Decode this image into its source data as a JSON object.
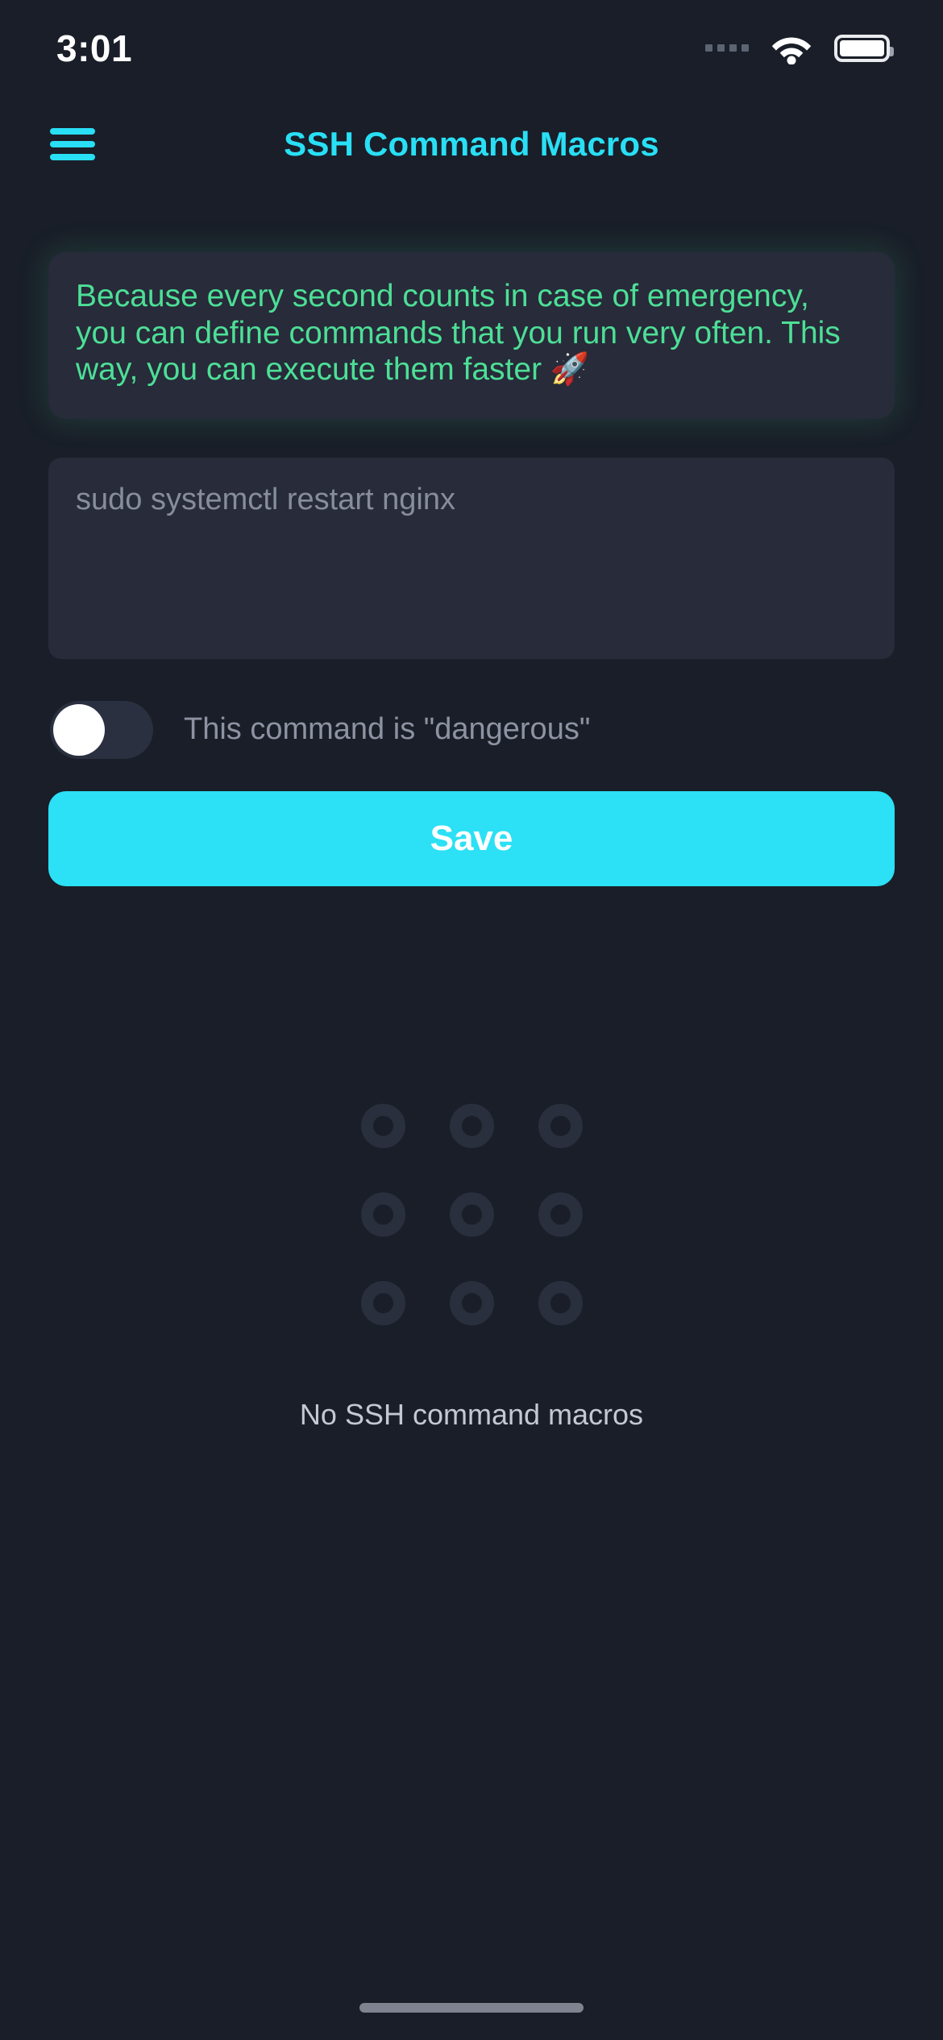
{
  "status_bar": {
    "time": "3:01",
    "signal_icon": "signal-dots-icon",
    "wifi_icon": "wifi-icon",
    "battery_icon": "battery-full-icon"
  },
  "app_bar": {
    "menu_icon": "hamburger-menu-icon",
    "title": "SSH Command Macros",
    "title_color": "#29dff5"
  },
  "info_banner": {
    "text": "Because every second counts in case of emergency, you can define commands that you run very often. This way, you can execute them faster 🚀",
    "text_color": "#4ddf96",
    "background_color": "#272b3a"
  },
  "command_input": {
    "value": "",
    "placeholder": "sudo systemctl restart nginx",
    "background_color": "#272b3a"
  },
  "danger_toggle": {
    "label": "This command is \"dangerous\"",
    "state": "off",
    "track_color": "#2b3040",
    "knob_color": "#ffffff"
  },
  "save_button": {
    "label": "Save",
    "background_color": "#2ce0f5",
    "text_color": "#ffffff"
  },
  "empty_state": {
    "illustration_icon": "rings-grid-icon",
    "ring_count": 9,
    "ring_color": "#2a2f3e",
    "message": "No SSH command macros"
  },
  "home_indicator": {
    "icon": "home-indicator-bar"
  }
}
